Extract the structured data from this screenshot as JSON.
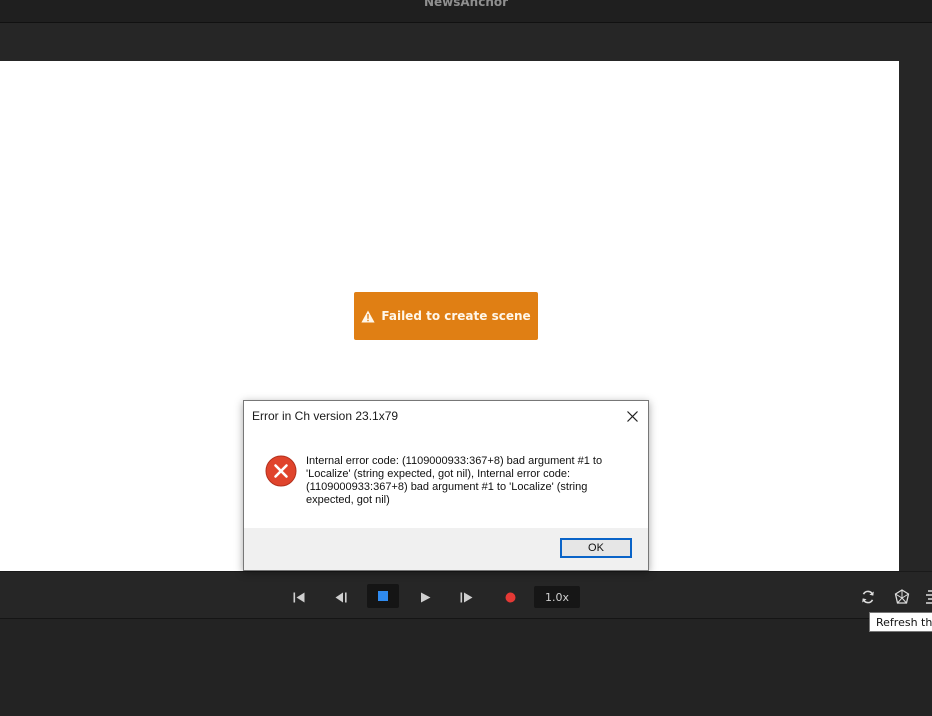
{
  "window": {
    "title": "NewsAnchor"
  },
  "stage": {
    "error_banner": "Failed to create scene",
    "banner_color": "#e07f14",
    "banner_icon": "warning-triangle-icon"
  },
  "transport": {
    "speed": "1.0x",
    "buttons": [
      "skip-to-start-icon",
      "step-back-icon",
      "stop-icon",
      "play-icon",
      "step-forward-icon",
      "record-icon"
    ],
    "stop_color": "#2f8bf0",
    "record_color": "#e53935"
  },
  "right_tools": {
    "icons": [
      "refresh-icon",
      "puppet-icon",
      "more-icon"
    ]
  },
  "tooltip": {
    "text": "Refresh the"
  },
  "dialog": {
    "title": "Error in Ch version 23.1x79",
    "icon": "error-icon",
    "icon_color": "#e0442c",
    "message": "Internal error code: (1109000933:367+8) bad argument #1 to 'Localize' (string expected, got nil), Internal error code: (1109000933:367+8) bad argument #1 to 'Localize' (string expected, got nil)",
    "ok_label": "OK"
  }
}
